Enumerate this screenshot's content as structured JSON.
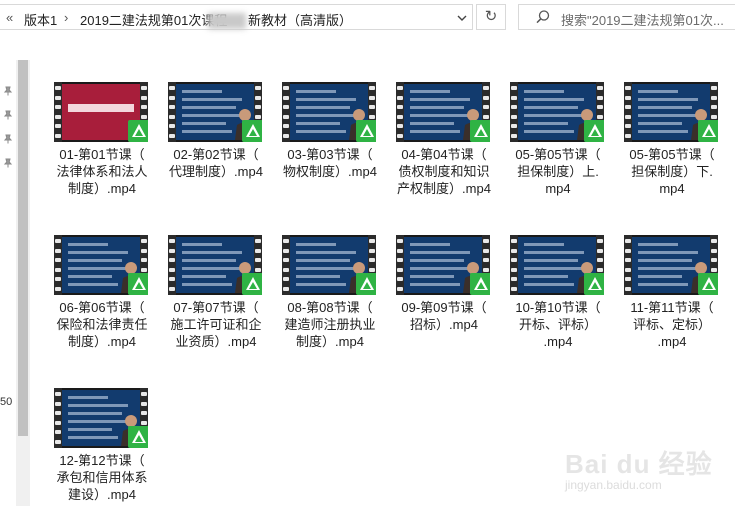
{
  "toolbar": {
    "back_label": "«",
    "crumbs": [
      "版本1",
      "2019二建法规第01次课程",
      "新教材（高清版）"
    ],
    "refresh_label": "↻",
    "dropdown_label": "⌄",
    "search_placeholder": "搜索\"2019二建法规第01次..."
  },
  "nav": {
    "partial_number": "50"
  },
  "files": [
    {
      "lines": [
        "01-第01节课（",
        "法律体系和法人",
        "制度）.mp4"
      ],
      "thumb": "red"
    },
    {
      "lines": [
        "02-第02节课（",
        "代理制度）.mp4"
      ],
      "thumb": "blue"
    },
    {
      "lines": [
        "03-第03节课（",
        "物权制度）.mp4"
      ],
      "thumb": "blue"
    },
    {
      "lines": [
        "04-第04节课（",
        "债权制度和知识",
        "产权制度）.mp4"
      ],
      "thumb": "blue"
    },
    {
      "lines": [
        "05-第05节课（",
        "担保制度）上.",
        "mp4"
      ],
      "thumb": "blue"
    },
    {
      "lines": [
        "05-第05节课（",
        "担保制度）下.",
        "mp4"
      ],
      "thumb": "blue"
    },
    {
      "lines": [
        "06-第06节课（",
        "保险和法律责任",
        "制度）.mp4"
      ],
      "thumb": "blue"
    },
    {
      "lines": [
        "07-第07节课（",
        "施工许可证和企",
        "业资质）.mp4"
      ],
      "thumb": "blue"
    },
    {
      "lines": [
        "08-第08节课（",
        "建造师注册执业",
        "制度）.mp4"
      ],
      "thumb": "blue"
    },
    {
      "lines": [
        "09-第09节课（",
        "招标）.mp4"
      ],
      "thumb": "blue"
    },
    {
      "lines": [
        "10-第10节课（",
        "开标、评标）",
        ".mp4"
      ],
      "thumb": "blue"
    },
    {
      "lines": [
        "11-第11节课（",
        "评标、定标）",
        ".mp4"
      ],
      "thumb": "blue"
    },
    {
      "lines": [
        "12-第12节课（",
        "承包和信用体系",
        "建设）.mp4"
      ],
      "thumb": "blue"
    }
  ],
  "watermark": {
    "logo": "Bai du 经验",
    "url": "jingyan.baidu.com"
  },
  "colors": {
    "slide_blue": "#123b6e",
    "slide_red": "#a81e3b",
    "badge_green": "#2fb344"
  }
}
